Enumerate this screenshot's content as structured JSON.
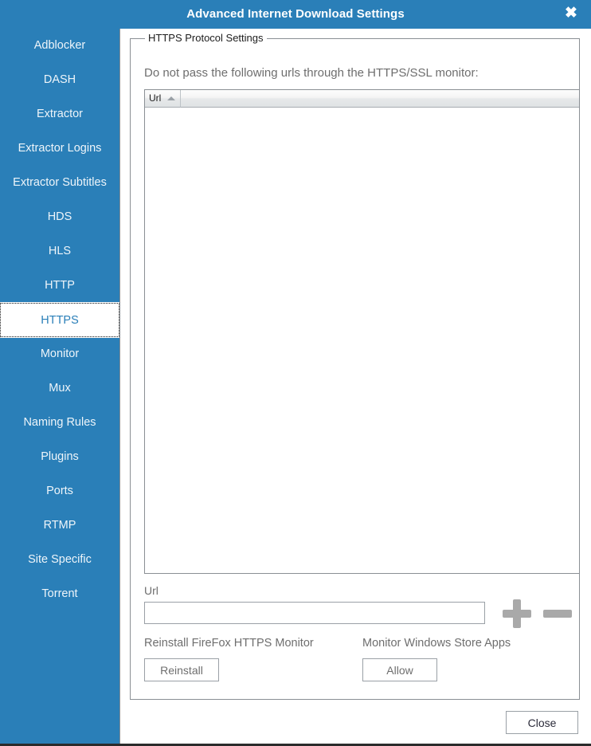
{
  "window": {
    "title": "Advanced Internet Download Settings",
    "close_icon": "close-x-icon",
    "titlebar_color": "#2a7fb8"
  },
  "sidebar": {
    "accent_color": "#2a7fb8",
    "selected": "HTTPS",
    "items": [
      {
        "label": "Adblocker",
        "selected": false
      },
      {
        "label": "DASH",
        "selected": false
      },
      {
        "label": "Extractor",
        "selected": false
      },
      {
        "label": "Extractor Logins",
        "selected": false
      },
      {
        "label": "Extractor Subtitles",
        "selected": false
      },
      {
        "label": "HDS",
        "selected": false
      },
      {
        "label": "HLS",
        "selected": false
      },
      {
        "label": "HTTP",
        "selected": false
      },
      {
        "label": "HTTPS",
        "selected": true
      },
      {
        "label": "Monitor",
        "selected": false
      },
      {
        "label": "Mux",
        "selected": false
      },
      {
        "label": "Naming Rules",
        "selected": false
      },
      {
        "label": "Plugins",
        "selected": false
      },
      {
        "label": "Ports",
        "selected": false
      },
      {
        "label": "RTMP",
        "selected": false
      },
      {
        "label": "Site Specific",
        "selected": false
      },
      {
        "label": "Torrent",
        "selected": false
      }
    ]
  },
  "main": {
    "group_legend": "HTTPS Protocol Settings",
    "description": "Do not pass the following urls through the HTTPS/SSL monitor:",
    "list": {
      "columns": [
        {
          "label": "Url",
          "sort": "ascending",
          "sort_icon": "sort-ascending-icon"
        },
        {
          "label": ""
        }
      ],
      "rows": []
    },
    "url_field": {
      "label": "Url",
      "value": "",
      "placeholder": ""
    },
    "add_icon": "plus-icon",
    "remove_icon": "minus-icon",
    "reinstall": {
      "label": "Reinstall FireFox HTTPS Monitor",
      "button": "Reinstall"
    },
    "store_apps": {
      "label": "Monitor Windows Store Apps",
      "button": "Allow"
    }
  },
  "footer": {
    "close_button": "Close"
  }
}
